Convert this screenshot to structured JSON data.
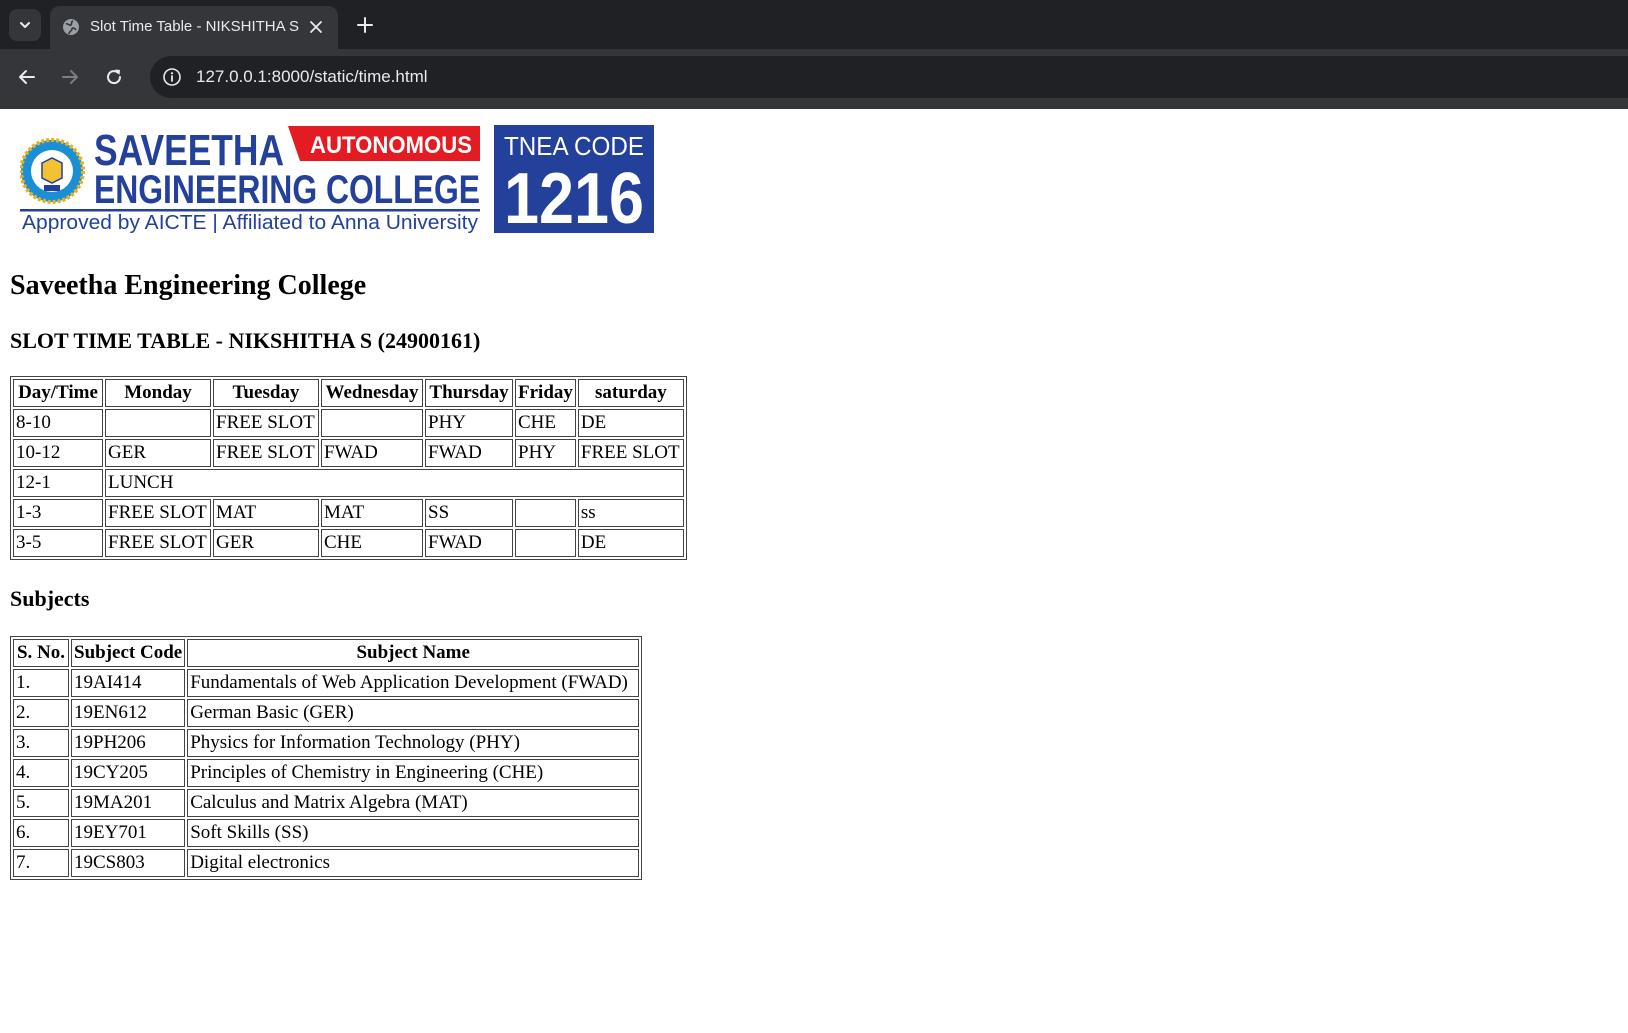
{
  "browser": {
    "tab_title": "Slot Time Table - NIKSHITHA S",
    "url": "127.0.0.1:8000/static/time.html"
  },
  "logo": {
    "line1": "SAVEETHA",
    "badge": "AUTONOMOUS",
    "line2": "ENGINEERING COLLEGE",
    "line3": "Approved by AICTE  |  Affiliated to Anna University",
    "tnea_label": "TNEA CODE",
    "tnea_code": "1216",
    "brand_blue": "#23409a",
    "brand_red": "#e31b23"
  },
  "page": {
    "college_name": "Saveetha Engineering College",
    "timetable_heading": "SLOT TIME TABLE - NIKSHITHA S (24900161)",
    "subjects_heading": "Subjects"
  },
  "timetable": {
    "headers": [
      "Day/Time",
      "Monday",
      "Tuesday",
      "Wednesday",
      "Thursday",
      "Friday",
      "saturday"
    ],
    "rows": [
      [
        "8-10",
        "",
        "FREE SLOT",
        "",
        "PHY",
        "CHE",
        "DE"
      ],
      [
        "10-12",
        "GER",
        "FREE SLOT",
        "FWAD",
        "FWAD",
        "PHY",
        "FREE SLOT"
      ],
      [
        "12-1",
        "LUNCH"
      ],
      [
        "1-3",
        "FREE SLOT",
        "MAT",
        "MAT",
        "SS",
        "",
        "ss"
      ],
      [
        "3-5",
        "FREE SLOT",
        "GER",
        "CHE",
        "FWAD",
        "",
        "DE"
      ]
    ]
  },
  "subjects": {
    "headers": [
      "S. No.",
      "Subject Code",
      "Subject Name"
    ],
    "rows": [
      [
        "1.",
        "19AI414",
        "Fundamentals of Web Application Development (FWAD)"
      ],
      [
        "2.",
        "19EN612",
        "German Basic (GER)"
      ],
      [
        "3.",
        "19PH206",
        "Physics for Information Technology (PHY)"
      ],
      [
        "4.",
        "19CY205",
        "Principles of Chemistry in Engineering (CHE)"
      ],
      [
        "5.",
        "19MA201",
        "Calculus and Matrix Algebra (MAT)"
      ],
      [
        "6.",
        "19EY701",
        "Soft Skills (SS)"
      ],
      [
        "7.",
        "19CS803",
        "Digital electronics"
      ]
    ]
  }
}
